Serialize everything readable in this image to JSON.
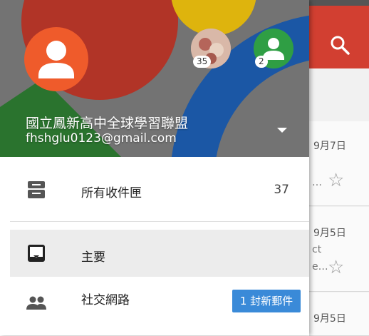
{
  "colors": {
    "toolbar_red": "#d23f31",
    "avatar_orange": "#ef5b2b",
    "avatar_green": "#2f9e44",
    "chip_blue": "#3a8ad8",
    "selected_bg": "#ececec"
  },
  "account": {
    "name": "國立鳳新高中全球學習聯盟",
    "email": "fhshglu0123@gmail.com",
    "other_accounts": [
      {
        "badge": "35",
        "icon": "photo-avatar"
      },
      {
        "badge": "2",
        "icon": "person-avatar"
      }
    ]
  },
  "menu": {
    "all_inbox": {
      "label": "所有收件匣",
      "count": "37",
      "icon": "all-inboxes-icon"
    },
    "primary": {
      "label": "主要",
      "icon": "inbox-icon"
    },
    "social": {
      "label": "社交網路",
      "chip": "1 封新郵件",
      "icon": "people-icon"
    }
  },
  "background_list": {
    "rows": [
      {
        "date": "9月7日",
        "snippet": "…"
      },
      {
        "date": "9月5日",
        "snippet_top": "ct",
        "snippet": "e…"
      },
      {
        "date": "9月5日"
      }
    ]
  }
}
